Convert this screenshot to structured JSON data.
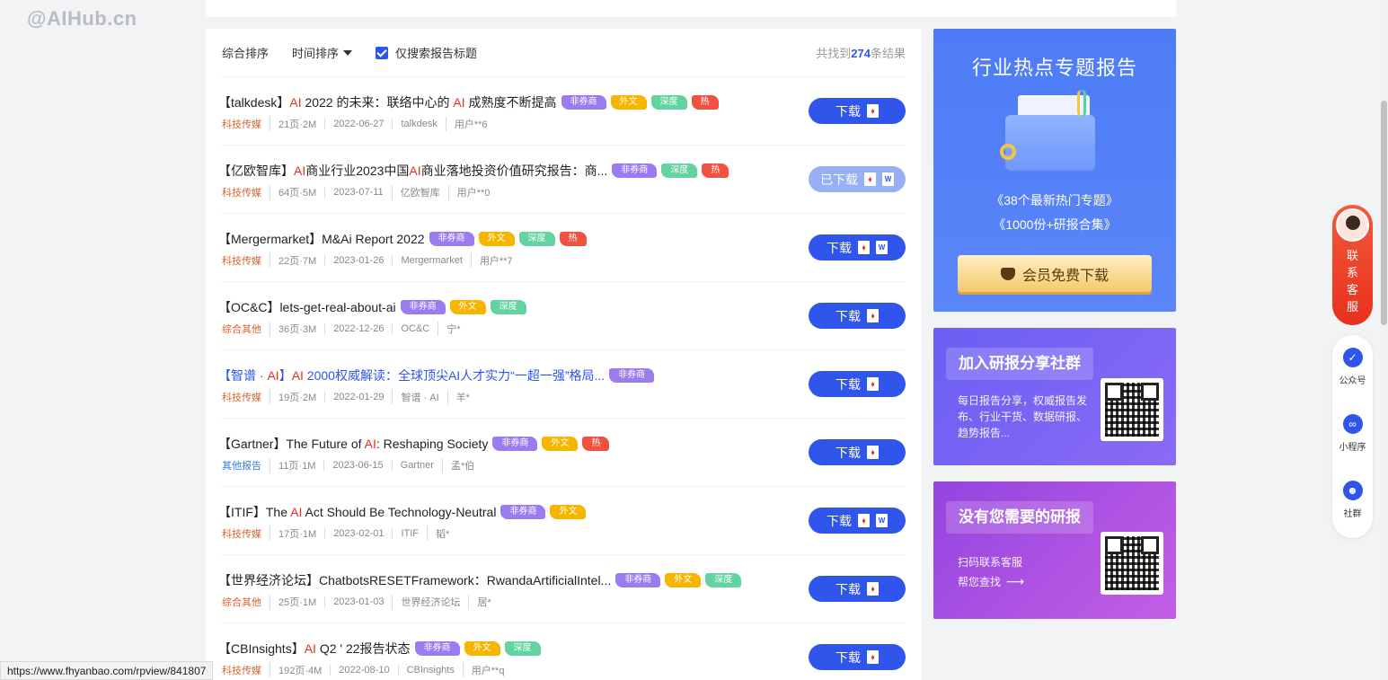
{
  "watermark": "@AIHub.cn",
  "sortbar": {
    "sort_all": "综合排序",
    "sort_time": "时间排序",
    "title_only": "仅搜索报告标题",
    "count_prefix": "共找到",
    "count": "274",
    "count_suffix": "条结果"
  },
  "reports": [
    {
      "title_pre": "【talkdesk】",
      "hl1": "AI",
      "title_mid": " 2022 的未来：联络中心的 ",
      "hl2": "AI",
      "title_post": " 成熟度不断提高",
      "tags": [
        "非券商",
        "外文",
        "深度",
        "热"
      ],
      "category": "科技传媒",
      "pages": "21页·2M",
      "date": "2022-06-27",
      "source": "talkdesk",
      "user": "用户**6",
      "button": "下载"
    },
    {
      "title_pre": "【亿欧智库】",
      "hl1": "AI",
      "title_mid": "商业行业2023中国",
      "hl2": "AI",
      "title_post": "商业落地投资价值研究报告：商...",
      "tags": [
        "非券商",
        "深度",
        "热"
      ],
      "category": "科技传媒",
      "pages": "64页·5M",
      "date": "2023-07-11",
      "source": "亿欧智库",
      "user": "用户**0",
      "button": "已下载"
    },
    {
      "title_pre": "【Mergermarket】M&Ai Report 2022",
      "hl1": "",
      "title_mid": "",
      "hl2": "",
      "title_post": "",
      "tags": [
        "非券商",
        "外文",
        "深度",
        "热"
      ],
      "category": "科技传媒",
      "pages": "22页·7M",
      "date": "2023-01-26",
      "source": "Mergermarket",
      "user": "用户**7",
      "button": "下载"
    },
    {
      "title_pre": "【OC&C】lets-get-real-about-ai",
      "hl1": "",
      "title_mid": "",
      "hl2": "",
      "title_post": "",
      "tags": [
        "非券商",
        "外文",
        "深度"
      ],
      "category": "综合其他",
      "pages": "36页·3M",
      "date": "2022-12-26",
      "source": "OC&C",
      "user": "宁*",
      "button": "下载"
    },
    {
      "title_pre": "【智谱 · ",
      "hl1": "AI",
      "title_mid": "】",
      "hl2": "AI",
      "title_post": " 2000权威解读：全球顶尖AI人才实力“一超一强”格局...",
      "tags": [
        "非券商"
      ],
      "category": "科技传媒",
      "pages": "19页·2M",
      "date": "2022-01-29",
      "source": "智谱 · AI",
      "user": "羊*",
      "button": "下载"
    },
    {
      "title_pre": "【Gartner】The Future of ",
      "hl1": "AI",
      "title_mid": ": Reshaping Society",
      "hl2": "",
      "title_post": "",
      "tags": [
        "非券商",
        "外文",
        "热"
      ],
      "category": "其他报告",
      "pages": "11页·1M",
      "date": "2023-06-15",
      "source": "Gartner",
      "user": "孟*伯",
      "button": "下载"
    },
    {
      "title_pre": "【ITIF】The ",
      "hl1": "AI",
      "title_mid": " Act Should Be Technology-Neutral",
      "hl2": "",
      "title_post": "",
      "tags": [
        "非券商",
        "外文"
      ],
      "category": "科技传媒",
      "pages": "17页·1M",
      "date": "2023-02-01",
      "source": "ITIF",
      "user": "韬*",
      "button": "下载"
    },
    {
      "title_pre": "【世界经济论坛】ChatbotsRESETFramework：RwandaArtificialIntel...",
      "hl1": "",
      "title_mid": "",
      "hl2": "",
      "title_post": "",
      "tags": [
        "非券商",
        "外文",
        "深度"
      ],
      "category": "综合其他",
      "pages": "25页·1M",
      "date": "2023-01-03",
      "source": "世界经济论坛",
      "user": "居*",
      "button": "下载"
    },
    {
      "title_pre": "【CBInsights】",
      "hl1": "AI",
      "title_mid": " Q2 ' 22报告状态",
      "hl2": "",
      "title_post": "",
      "tags": [
        "非券商",
        "外文",
        "深度"
      ],
      "category": "科技传媒",
      "pages": "192页·4M",
      "date": "2022-08-10",
      "source": "CBInsights",
      "user": "用户**q",
      "button": "下载"
    }
  ],
  "sidebar": {
    "hot": {
      "title": "行业热点专题报告",
      "line1": "《38个最新热门专题》",
      "line2": "《1000份+研报合集》",
      "button": "会员免费下载"
    },
    "group": {
      "title": "加入研报分享社群",
      "desc": "每日报告分享，权威报告发布、行业干货、数据研报、趋势报告..."
    },
    "need": {
      "title": "没有您需要的研报",
      "desc1": "扫码联系客服",
      "desc2": "帮您查找"
    }
  },
  "float": {
    "service": [
      "联",
      "系",
      "客",
      "服"
    ],
    "items": [
      "公众号",
      "小程序",
      "社群"
    ]
  },
  "status_url": "https://www.fhyanbao.com/rpview/841807"
}
